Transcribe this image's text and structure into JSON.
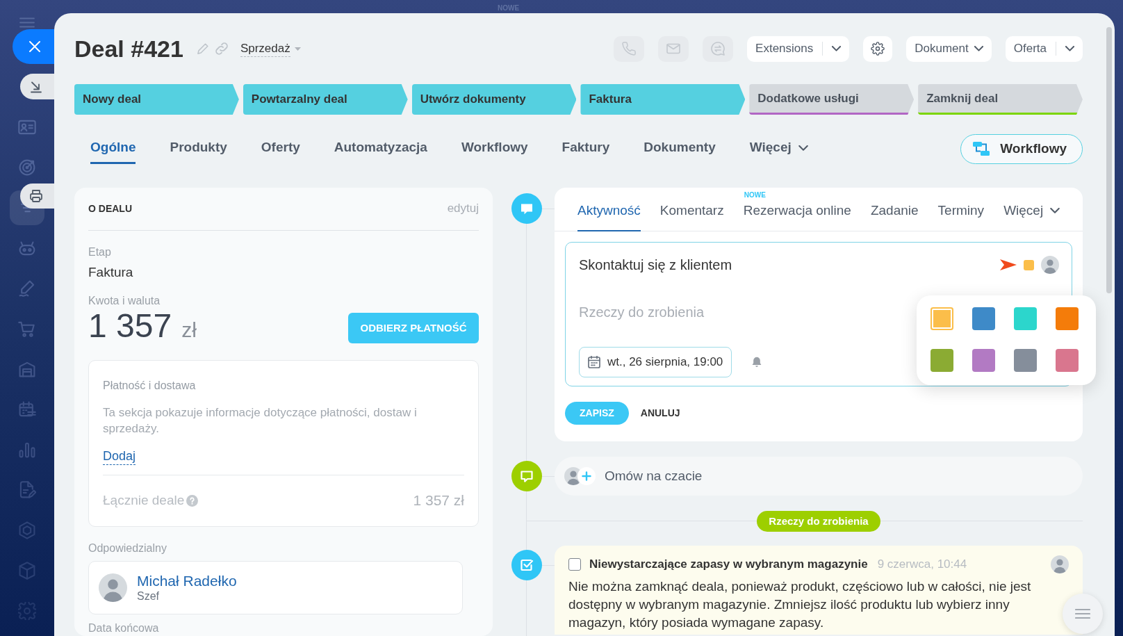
{
  "top_badge": "NOWE",
  "sidebar": {
    "items": [
      {
        "selected": false
      },
      {
        "selected": false
      },
      {
        "selected": true
      },
      {
        "selected": false
      },
      {
        "selected": false
      },
      {
        "selected": false
      },
      {
        "selected": false
      },
      {
        "selected": false
      },
      {
        "selected": false
      },
      {
        "selected": false
      },
      {
        "selected": false
      },
      {
        "selected": false
      },
      {
        "selected": false
      }
    ]
  },
  "header": {
    "title": "Deal #421",
    "category": "Sprzedaż",
    "communication": [
      {
        "disabled": true
      },
      {
        "disabled": true
      },
      {
        "disabled": true
      }
    ],
    "buttons": [
      {
        "kind": "split",
        "label": "Extensions"
      },
      {
        "kind": "settings"
      },
      {
        "kind": "dropdown",
        "label": "Dokument"
      },
      {
        "kind": "split",
        "label": "Oferta"
      }
    ]
  },
  "stages": [
    {
      "label": "Nowy deal",
      "reached": true,
      "color": "#55d0e0"
    },
    {
      "label": "Powtarzalny deal",
      "reached": true,
      "color": "#55d0e0"
    },
    {
      "label": "Utwórz dokumenty",
      "reached": true,
      "color": "#55d0e0"
    },
    {
      "label": "Faktura",
      "reached": true,
      "color": "#55d0e0"
    },
    {
      "label": "Dodatkowe usługi",
      "reached": false,
      "color": "#b166c4"
    },
    {
      "label": "Zamknij deal",
      "reached": false,
      "color": "#7bd500"
    }
  ],
  "tabs": [
    {
      "label": "Ogólne",
      "selected": true,
      "kind": "tab"
    },
    {
      "label": "Produkty",
      "selected": false,
      "kind": "tab"
    },
    {
      "label": "Oferty",
      "selected": false,
      "kind": "tab"
    },
    {
      "label": "Automatyzacja",
      "selected": false,
      "kind": "tab"
    },
    {
      "label": "Workflowy",
      "selected": false,
      "kind": "tab"
    },
    {
      "label": "Faktury",
      "selected": false,
      "kind": "tab"
    },
    {
      "label": "Dokumenty",
      "selected": false,
      "kind": "tab"
    },
    {
      "label": "Więcej",
      "selected": false,
      "kind": "menu"
    }
  ],
  "workflow_button": {
    "label": "Workflowy"
  },
  "deal_card": {
    "title": "O DEALU",
    "edit_link": "edytuj",
    "stage": {
      "label": "Etap",
      "value": "Faktura"
    },
    "amount": {
      "label": "Kwota i waluta",
      "value": "1 357",
      "currency": "zł",
      "button": "ODBIERZ PŁATNOŚĆ"
    },
    "payment": {
      "title": "Płatność i dostawa",
      "description": "Ta sekcja pokazuje informacje dotyczące płatności, dostaw i sprzedaży.",
      "link": "Dodaj",
      "total_label": "Łącznie deale",
      "total_value": "1 357 zł"
    },
    "responsible": {
      "label": "Odpowiedzialny",
      "name": "Michał Radełko",
      "role": "Szef"
    },
    "next_field": {
      "label": "Data końcowa"
    }
  },
  "activity": {
    "tabs": [
      {
        "label": "Aktywność",
        "selected": true,
        "kind": "tab"
      },
      {
        "label": "Komentarz",
        "selected": false,
        "kind": "tab"
      },
      {
        "label": "Rezerwacja online",
        "selected": false,
        "kind": "tab",
        "badge": "NOWE"
      },
      {
        "label": "Zadanie",
        "selected": false,
        "kind": "tab"
      },
      {
        "label": "Terminy",
        "selected": false,
        "kind": "tab"
      },
      {
        "label": "Więcej",
        "selected": false,
        "kind": "menu"
      }
    ],
    "editor": {
      "title": "Skontaktuj się z klientem",
      "color": "#fbbe4a",
      "placeholder": "Rzeczy do zrobienia",
      "deadline": "wt., 26 sierpnia, 19:00"
    },
    "color_picker": {
      "swatches": [
        {
          "color": "#fbbe4a",
          "selected": true
        },
        {
          "color": "#3e8ac8",
          "selected": false
        },
        {
          "color": "#2cd6cc",
          "selected": false
        },
        {
          "color": "#f47c0a",
          "selected": false
        },
        {
          "color": "#8bab33",
          "selected": false
        },
        {
          "color": "#b27ac3",
          "selected": false
        },
        {
          "color": "#858e9b",
          "selected": false
        },
        {
          "color": "#d9768e",
          "selected": false
        }
      ]
    },
    "buttons": [
      {
        "kind": "primary",
        "label": "ZAPISZ"
      },
      {
        "kind": "link",
        "label": "ANULUJ"
      }
    ]
  },
  "chat_prompt": {
    "label": "Omów na czacie"
  },
  "todo_divider": {
    "label": "Rzeczy do zrobienia"
  },
  "task": {
    "checked": false,
    "title": "Niewystarczające zapasy w wybranym magazynie",
    "time": "9 czerwca, 10:44",
    "body": "Nie można zamknąć deala, ponieważ produkt, częściowo lub w całości, nie jest dostępny w wybranym magazynie. Zmniejsz ilość produktu lub wybierz inny magazyn, który posiada wymagane zapasy."
  }
}
